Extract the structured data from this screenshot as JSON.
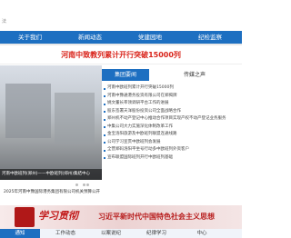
{
  "header": {
    "site_caption": "法",
    "nav": [
      {
        "label": "关于我们"
      },
      {
        "label": "新闻动态"
      },
      {
        "label": "党建园地"
      },
      {
        "label": "纪检监察"
      }
    ]
  },
  "headline": "河南中致教列累计开行突破15000列",
  "news": {
    "tabs": [
      {
        "label": "集团要闻",
        "active": true
      },
      {
        "label": "传媒之声",
        "active": false
      }
    ],
    "items": [
      "河南中欧班列累计开行突破15000列",
      "河南中豫通港务投资有限公司在郑揭牌",
      "姚文董长率领调研平台工作的进展",
      "股东签署天洋股份投资公司全面战略合作",
      "郑州机不动产登记中心推动合作项目实现产权不动产登记业务服务",
      "中集公司大力实施深化体制改革工作",
      "金宝洛阳旅游及中欧班列联盟连通线路",
      "公司学习宣贯中欧班列会发展",
      "全营郑码洛阳平坐号行动多中欧班列外资客户",
      "宣布联盟国际班列开行中欧班列基础"
    ],
    "slide_caption": "河南中欧班列(郑州)——中欧班列(郑州)集结中心",
    "dots": 4,
    "active_dot": 1
  },
  "announcement": "2025年河南中豫国际港务集团有限公司机关预算公开",
  "banner": {
    "calligraphy": "学习贯彻",
    "text": "习近平新时代中国特色社会主义思想"
  },
  "bottom_tabs": [
    {
      "label": "通知",
      "active": true
    },
    {
      "label": "工作动态",
      "active": false
    },
    {
      "label": "以案说纪",
      "active": false
    },
    {
      "label": "纪律学习",
      "active": false
    },
    {
      "label": "中心",
      "active": false
    }
  ],
  "colors": {
    "nav_blue": "#1d6fc1",
    "headline_red": "#d9231a",
    "banner_red": "#b81e1e"
  }
}
